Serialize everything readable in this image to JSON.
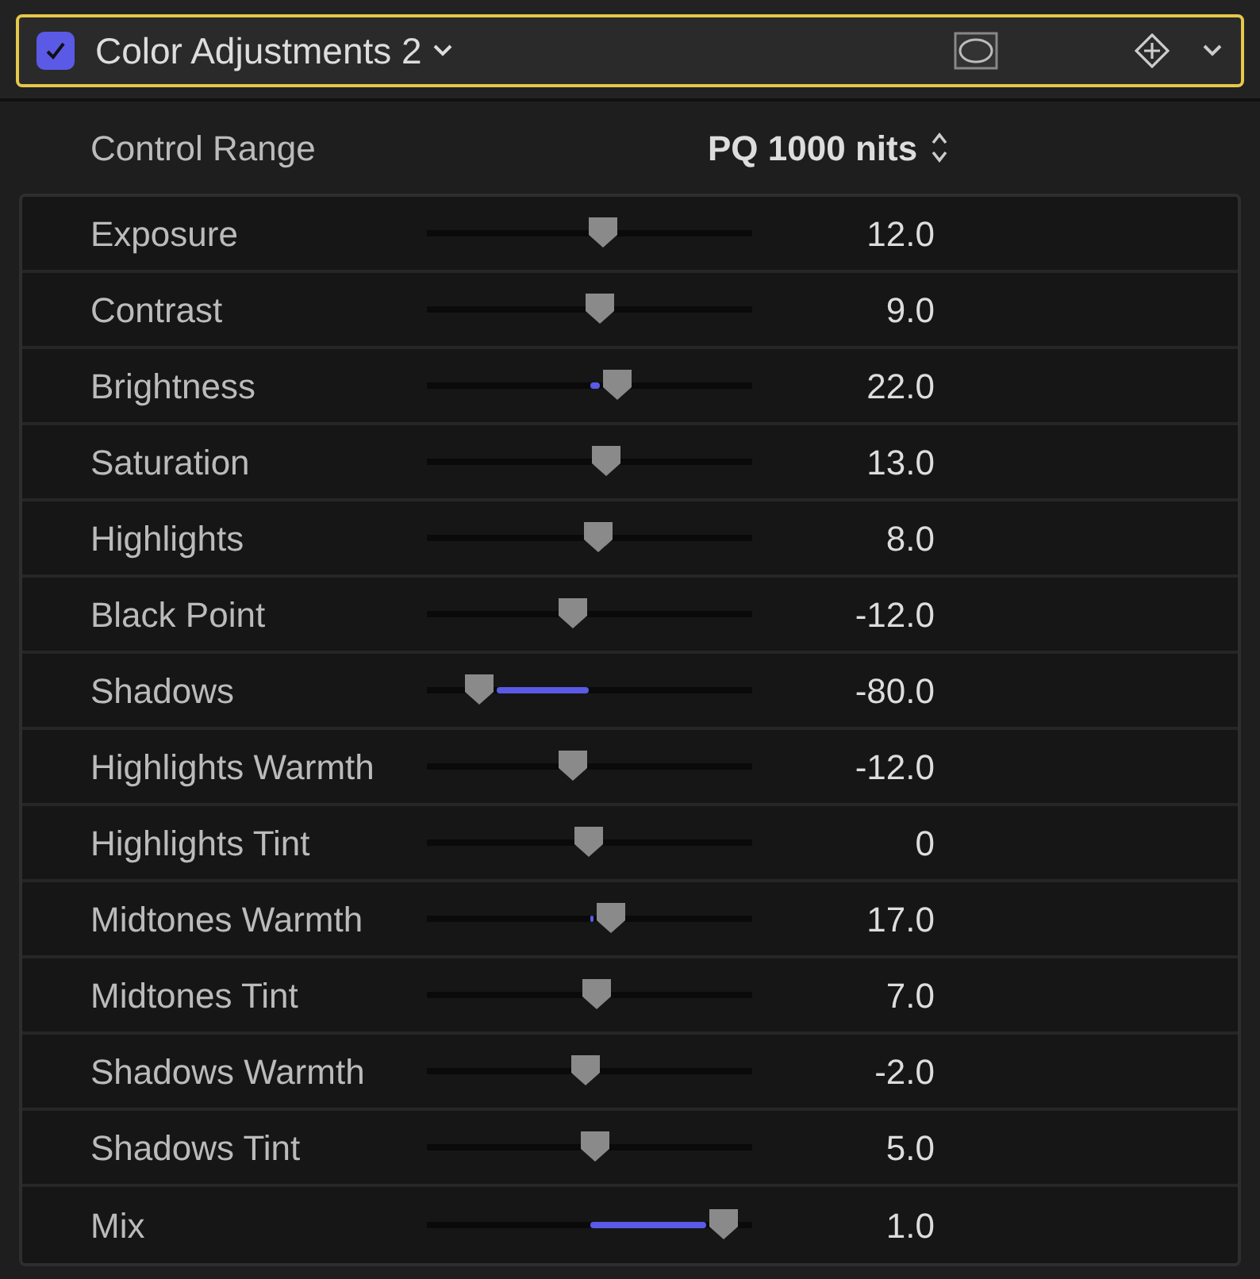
{
  "header": {
    "title": "Color Adjustments 2",
    "enabled": true
  },
  "control_range": {
    "label": "Control Range",
    "value": "PQ 1000 nits"
  },
  "sliders": [
    {
      "name": "Exposure",
      "level": 0.546,
      "reading": "12.0"
    },
    {
      "name": "Contrast",
      "level": 0.536,
      "reading": "9.0"
    },
    {
      "name": "Brightness",
      "level": 0.596,
      "reading": "22.0"
    },
    {
      "name": "Saturation",
      "level": 0.557,
      "reading": "13.0"
    },
    {
      "name": "Highlights",
      "level": 0.53,
      "reading": "8.0"
    },
    {
      "name": "Black Point",
      "level": 0.443,
      "reading": "-12.0"
    },
    {
      "name": "Shadows",
      "level": 0.12,
      "reading": "-80.0"
    },
    {
      "name": "Highlights Warmth",
      "level": 0.443,
      "reading": "-12.0"
    },
    {
      "name": "Highlights Tint",
      "level": 0.497,
      "reading": "0"
    },
    {
      "name": "Midtones Warmth",
      "level": 0.574,
      "reading": "17.0"
    },
    {
      "name": "Midtones Tint",
      "level": 0.525,
      "reading": "7.0"
    },
    {
      "name": "Shadows Warmth",
      "level": 0.486,
      "reading": "-2.0"
    },
    {
      "name": "Shadows Tint",
      "level": 0.519,
      "reading": "5.0"
    },
    {
      "name": "Mix",
      "level": 0.962,
      "reading": "1.0"
    }
  ]
}
